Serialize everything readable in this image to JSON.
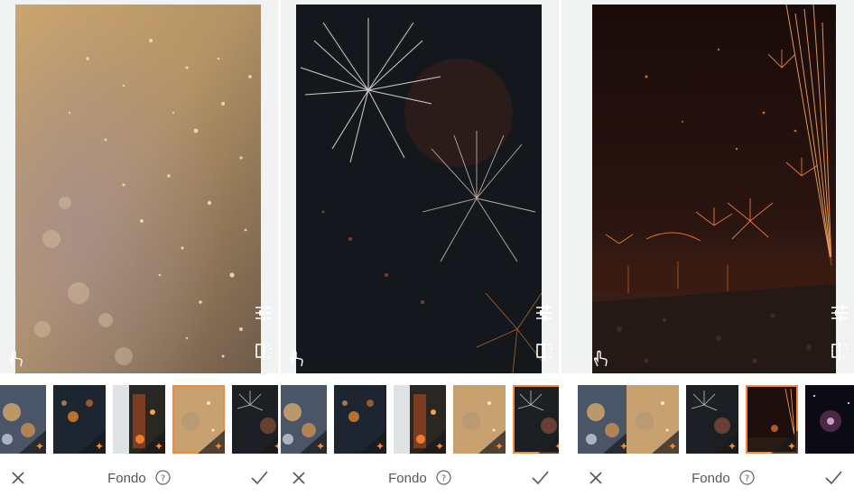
{
  "panels": [
    {
      "background": "glitter",
      "bar_label": "Fondo",
      "thumbnails": [
        {
          "icon": "city-lights-icon",
          "selected": false
        },
        {
          "icon": "bokeh-night-icon",
          "selected": false
        },
        {
          "icon": "street-lights-icon",
          "selected": false
        },
        {
          "icon": "glitter-icon",
          "selected": true
        },
        {
          "icon": "fireworks-icon",
          "selected": false
        }
      ]
    },
    {
      "background": "fireworks",
      "bar_label": "Fondo",
      "thumbnails": [
        {
          "icon": "city-lights-icon",
          "selected": false
        },
        {
          "icon": "bokeh-night-icon",
          "selected": false
        },
        {
          "icon": "street-lights-icon",
          "selected": false
        },
        {
          "icon": "glitter-icon",
          "selected": false
        },
        {
          "icon": "fireworks-icon",
          "selected": true
        }
      ]
    },
    {
      "background": "harbor-fireworks",
      "bar_label": "Fondo",
      "thumbnails": [
        {
          "icon": "city-lights-icon",
          "selected": false
        },
        {
          "icon": "glitter-icon",
          "selected": false
        },
        {
          "icon": "fireworks-icon",
          "selected": false
        },
        {
          "icon": "harbor-fireworks-icon",
          "selected": true
        },
        {
          "icon": "galaxy-icon",
          "selected": false
        }
      ]
    }
  ],
  "colors": {
    "accent": "#f28a3c",
    "canvas_bg": "#f1f3f3",
    "icon": "#ffffff",
    "bar_icon": "#555555"
  },
  "icons": [
    "adjust-sliders-icon",
    "compare-icon",
    "touch-icon",
    "close-icon",
    "check-icon",
    "help-icon",
    "sparkle-badge-icon"
  ]
}
